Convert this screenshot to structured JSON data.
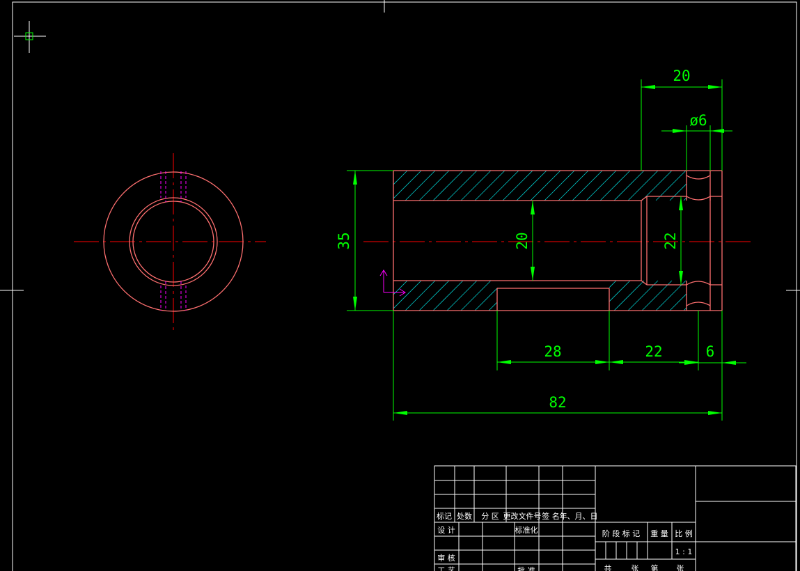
{
  "colors": {
    "background": "#000000",
    "frame": "#ffffff",
    "outline": "#ff6f6f",
    "hatch": "#00c8c8",
    "dimension": "#00ff00",
    "centerline": "#ff0000",
    "hidden": "#ff00ff",
    "ucs": "#ff00ff",
    "titleblock": "#ffffff"
  },
  "dimensions": {
    "top_length": "20",
    "hole_dia": "ø6",
    "outer_dia": "35",
    "bore_dia": "20",
    "counterbore_dia": "22",
    "slot_len": "28",
    "mid_len": "22",
    "end_len": "6",
    "total_len": "82"
  },
  "title_block": {
    "rev_marker": "标记",
    "rev_count": "处数",
    "rev_zone": "分 区",
    "rev_docno": "更改文件号",
    "rev_sign": "签 名",
    "rev_date": "年、月、日",
    "design": "设 计",
    "standardize": "标准化",
    "review": "审 核",
    "process": "工 艺",
    "approve": "批 准",
    "stage_mark": "阶 段 标 记",
    "weight": "重 量",
    "scale": "比 例",
    "scale_value": "1 : 1",
    "sheets_total": "共",
    "sheets_unit": "张",
    "sheet_no": "第",
    "sheet_unit": "张"
  }
}
